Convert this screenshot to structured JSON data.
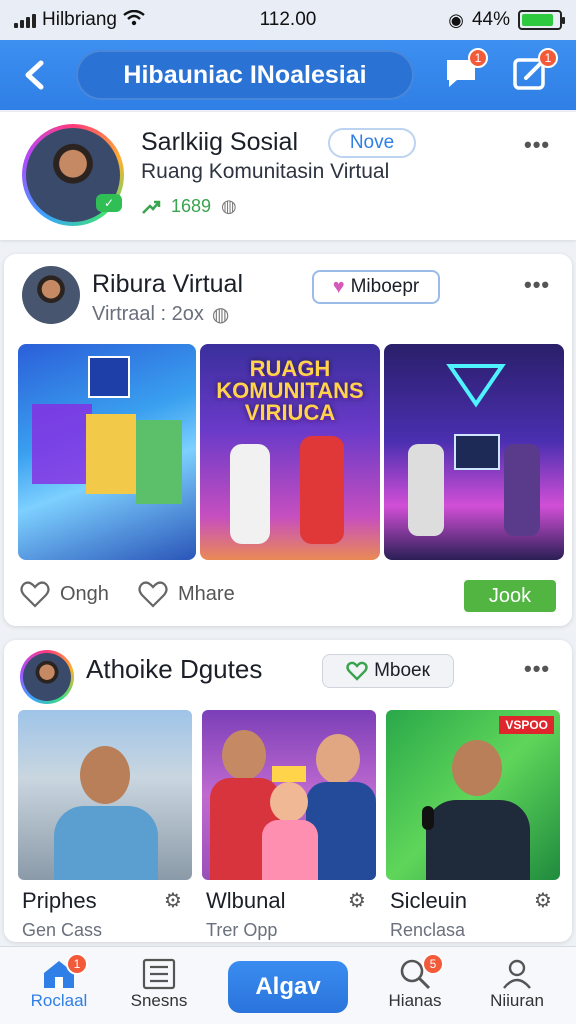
{
  "status_bar": {
    "carrier": "Hilbriang",
    "time": "112.00",
    "battery": "44%",
    "battery_level": 0.85
  },
  "header": {
    "title": "Hibauniac INoalesiai",
    "messages_badge": "1",
    "compose_badge": "1"
  },
  "profile": {
    "name": "Sarlkiig Sosial",
    "pill": "Nove",
    "subtitle": "Ruang Komunitasin Virtual",
    "stat": "1689"
  },
  "post1": {
    "title": "Ribura Virtual",
    "subtitle": "Virtraal : 2ox",
    "member_button": "Miboepr",
    "image_overlay": "RUAGH KOMUNITANS VIRIUCA",
    "actions": {
      "like": "Ongh",
      "share": "Mhare",
      "join": "Jook"
    }
  },
  "post2": {
    "title": "Athoike Dgutes",
    "member_button": "Mboeк",
    "tile_tag": "VSPOO",
    "people": [
      {
        "name": "Priphes",
        "role": "Gen Cass"
      },
      {
        "name": "Wlbunal",
        "role": "Trer Opp"
      },
      {
        "name": "Sicleuin",
        "role": "Renclasa"
      }
    ]
  },
  "bottom_nav": {
    "items": [
      {
        "label": "Roclaal",
        "badge": "1",
        "icon": "home-icon"
      },
      {
        "label": "Snesns",
        "icon": "list-icon"
      },
      {
        "label": "Hianas",
        "badge": "5",
        "icon": "search-icon"
      },
      {
        "label": "Niiuran",
        "icon": "profile-icon"
      }
    ],
    "center_button": "Algav"
  },
  "colors": {
    "primary": "#2f7fe6",
    "success": "#52b542",
    "badge": "#f25a3a"
  }
}
